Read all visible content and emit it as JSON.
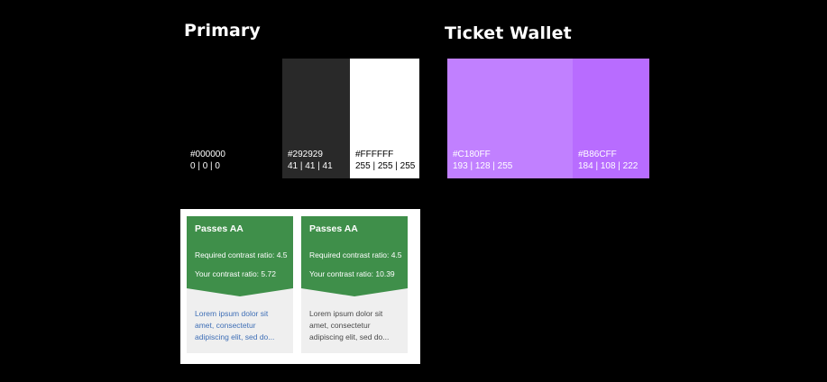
{
  "sections": {
    "primary_title": "Primary",
    "ticket_wallet_title": "Ticket Wallet"
  },
  "primary_swatches": [
    {
      "hex": "#000000",
      "rgb": "0 | 0 | 0",
      "color": "#000000"
    },
    {
      "hex": "#292929",
      "rgb": "41 | 41 | 41",
      "color": "#292929"
    },
    {
      "hex": "#FFFFFF",
      "rgb": "255 | 255 | 255",
      "color": "#FFFFFF"
    }
  ],
  "ticket_swatches": [
    {
      "hex": "#C180FF",
      "rgb": "193 | 128 | 255",
      "color": "#C180FF"
    },
    {
      "hex": "#B86CFF",
      "rgb": "184 | 108 | 222",
      "color": "#B86CFF"
    }
  ],
  "contrast_cards": [
    {
      "status": "Passes AA",
      "required": "Required contrast ratio: 4.5",
      "yours": "Your contrast ratio: 5.72",
      "sample": "Lorem ipsum dolor sit amet, consectetur adipiscing elit, sed do...",
      "header_color": "#3F8F4A",
      "sample_color": "#3F6FB6"
    },
    {
      "status": "Passes AA",
      "required": "Required contrast ratio: 4.5",
      "yours": "Your contrast ratio: 10.39",
      "sample": "Lorem ipsum dolor sit amet, consectetur adipiscing elit, sed do...",
      "header_color": "#3F8F4A",
      "sample_color": "#4A4A4A"
    }
  ]
}
